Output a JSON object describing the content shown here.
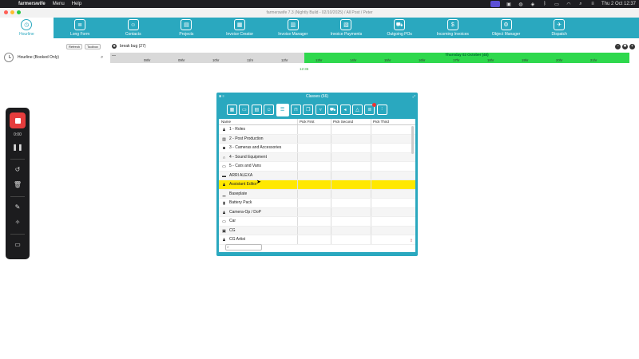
{
  "menubar": {
    "app_name": "farmerswife",
    "items": [
      "Menu",
      "Help"
    ],
    "window_title": "farmerswife 7.3 (Nightly Build - 02/10/2025) / All Post / Peter",
    "clock": "Thu 2 Oct  12:37"
  },
  "titlebar": {
    "text": "farmerswife 7.3 (Nightly Build - 02/10/2025) / All Post / Peter"
  },
  "toolbar": {
    "tools": [
      {
        "label": "Hourline",
        "icon": "clock-icon",
        "active": true
      },
      {
        "label": "Long Form",
        "icon": "longform-icon"
      },
      {
        "label": "Contacts",
        "icon": "contacts-icon"
      },
      {
        "label": "Projects",
        "icon": "briefcase-icon"
      },
      {
        "label": "Invoice Creator",
        "icon": "invoice-creator-icon"
      },
      {
        "label": "Invoice Manager",
        "icon": "invoice-manager-icon"
      },
      {
        "label": "Invoice Payments",
        "icon": "payments-icon"
      },
      {
        "label": "Outgoing POs",
        "icon": "cart-icon"
      },
      {
        "label": "Incoming Invoices",
        "icon": "incoming-invoice-icon"
      },
      {
        "label": "Object Manager",
        "icon": "object-manager-icon"
      },
      {
        "label": "Dispatch",
        "icon": "dispatch-icon"
      }
    ]
  },
  "hourline": {
    "label": "Hourline (Booked Only)",
    "chips": [
      "Refresh",
      "Toolbox"
    ],
    "view_title": "break bug (27)",
    "date_banner": "Thursday 02 October (40)",
    "now_time": "12:36",
    "ticks_grey": [
      "08hr",
      "09hr",
      "10hr",
      "11hr",
      "12hr"
    ],
    "ticks_green": [
      "13hr",
      "14hr",
      "15hr",
      "16hr",
      "17hr",
      "18hr",
      "19hr",
      "20hr",
      "21hr"
    ]
  },
  "recorder": {
    "timer": "0:00"
  },
  "classes": {
    "title": "Classes (66)",
    "columns": [
      "Name",
      "Pick First",
      "Pick Second",
      "Pick Third"
    ],
    "rows": [
      {
        "name": "1 - Roles",
        "icon": "person-icon"
      },
      {
        "name": "2 - Post Production",
        "icon": "film-icon"
      },
      {
        "name": "3 - Cameras and Accessories",
        "icon": "camera-icon"
      },
      {
        "name": "4 - Sound Equipment",
        "icon": "headphones-icon"
      },
      {
        "name": "5 - Cars and Vans",
        "icon": "car-icon"
      },
      {
        "name": "ARRI ALEXA",
        "icon": "camera-body-icon"
      },
      {
        "name": "Assistant Editor",
        "icon": "person-icon",
        "selected": true
      },
      {
        "name": "Baseplate",
        "icon": "baseplate-icon"
      },
      {
        "name": "Battery Pack",
        "icon": "battery-icon"
      },
      {
        "name": "Camera-Op / DoP",
        "icon": "person-icon"
      },
      {
        "name": "Car",
        "icon": "car-icon"
      },
      {
        "name": "CG",
        "icon": "monitor-icon"
      },
      {
        "name": "CG Artist",
        "icon": "person-icon"
      }
    ],
    "search_placeholder": ""
  }
}
